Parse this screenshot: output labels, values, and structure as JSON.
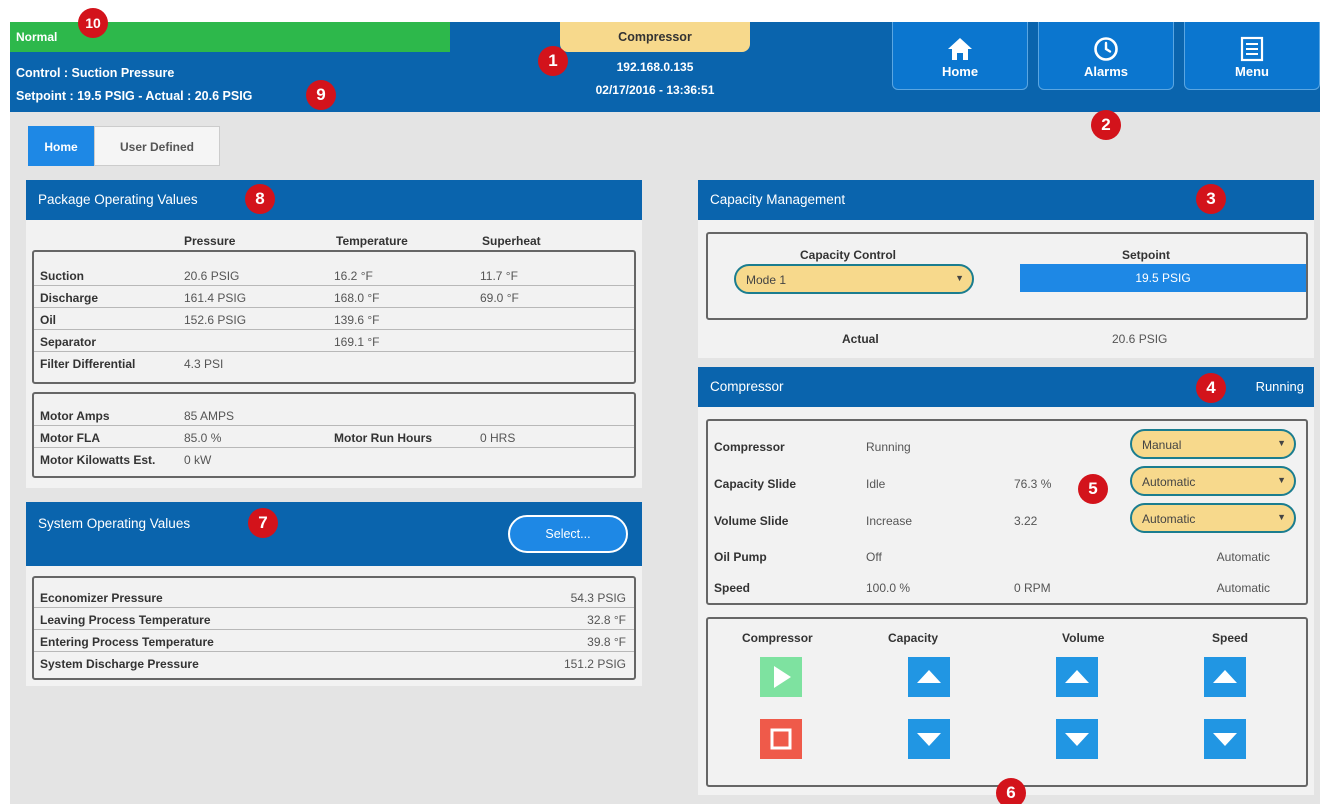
{
  "header": {
    "status": "Normal",
    "control_line": "Control : Suction Pressure",
    "setpoint_line": "Setpoint : 19.5 PSIG - Actual : 20.6 PSIG",
    "title": "Compressor",
    "ip": "192.168.0.135",
    "datetime": "02/17/2016 - 13:36:51",
    "nav": [
      {
        "label": "Home",
        "icon": "home-icon"
      },
      {
        "label": "Alarms",
        "icon": "clock-icon"
      },
      {
        "label": "Menu",
        "icon": "menu-icon"
      }
    ]
  },
  "tabs": [
    {
      "label": "Home",
      "active": true
    },
    {
      "label": "User Defined",
      "active": false
    }
  ],
  "package": {
    "title": "Package Operating Values",
    "columns": [
      "Pressure",
      "Temperature",
      "Superheat"
    ],
    "rows": [
      {
        "label": "Suction",
        "pressure": "20.6 PSIG",
        "temperature": "16.2 °F",
        "superheat": "11.7 °F"
      },
      {
        "label": "Discharge",
        "pressure": "161.4 PSIG",
        "temperature": "168.0 °F",
        "superheat": "69.0 °F"
      },
      {
        "label": "Oil",
        "pressure": "152.6 PSIG",
        "temperature": "139.6 °F",
        "superheat": ""
      },
      {
        "label": "Separator",
        "pressure": "",
        "temperature": "169.1 °F",
        "superheat": ""
      },
      {
        "label": "Filter Differential",
        "pressure": "4.3 PSI",
        "temperature": "",
        "superheat": ""
      }
    ],
    "motor": [
      {
        "label": "Motor Amps",
        "value": "85 AMPS",
        "label2": "",
        "value2": ""
      },
      {
        "label": "Motor FLA",
        "value": "85.0 %",
        "label2": "Motor Run Hours",
        "value2": "0 HRS"
      },
      {
        "label": "Motor Kilowatts Est.",
        "value": "0 kW",
        "label2": "",
        "value2": ""
      }
    ]
  },
  "system": {
    "title": "System Operating Values",
    "select_label": "Select...",
    "rows": [
      {
        "label": "Economizer Pressure",
        "value": "54.3 PSIG"
      },
      {
        "label": "Leaving Process Temperature",
        "value": "32.8 °F"
      },
      {
        "label": "Entering Process Temperature",
        "value": "39.8 °F"
      },
      {
        "label": "System Discharge Pressure",
        "value": "151.2 PSIG"
      }
    ]
  },
  "capacity": {
    "title": "Capacity Management",
    "control_label": "Capacity Control",
    "control_value": "Mode 1",
    "setpoint_label": "Setpoint",
    "setpoint_value": "19.5 PSIG",
    "actual_label": "Actual",
    "actual_value": "20.6 PSIG"
  },
  "compressor": {
    "title": "Compressor",
    "state": "Running",
    "rows": [
      {
        "label": "Compressor",
        "status": "Running",
        "value": "",
        "mode": "Manual",
        "dropdown": true
      },
      {
        "label": "Capacity Slide",
        "status": "Idle",
        "value": "76.3 %",
        "mode": "Automatic",
        "dropdown": true
      },
      {
        "label": "Volume Slide",
        "status": "Increase",
        "value": "3.22",
        "mode": "Automatic",
        "dropdown": true
      },
      {
        "label": "Oil Pump",
        "status": "Off",
        "value": "",
        "mode": "Automatic",
        "dropdown": false
      },
      {
        "label": "Speed",
        "status": "100.0 %",
        "value": "0 RPM",
        "mode": "Automatic",
        "dropdown": false
      }
    ],
    "controls": [
      "Compressor",
      "Capacity",
      "Volume",
      "Speed"
    ]
  },
  "callouts": [
    "1",
    "2",
    "3",
    "4",
    "5",
    "6",
    "7",
    "8",
    "9",
    "10"
  ],
  "colors": {
    "header": "#0a64ad",
    "status_normal": "#2db84b",
    "title_tab": "#f7d98c",
    "setpoint": "#1e88e5",
    "start": "#7ee2a0",
    "stop": "#ef5a4a",
    "arrow": "#2196e3",
    "callout": "#d3131b"
  }
}
